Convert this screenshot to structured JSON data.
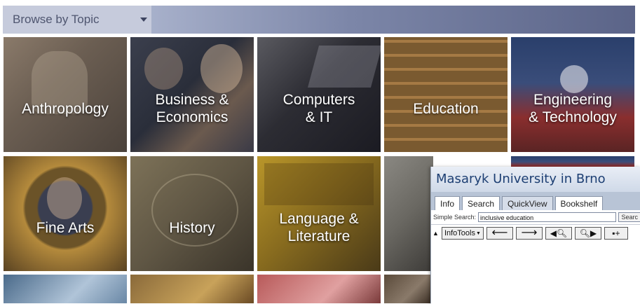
{
  "browse": {
    "label": "Browse by Topic"
  },
  "tiles": [
    {
      "label": "Anthropology"
    },
    {
      "label": "Business &\nEconomics"
    },
    {
      "label": "Computers\n& IT"
    },
    {
      "label": "Education"
    },
    {
      "label": "Engineering\n& Technology"
    },
    {
      "label": "Fine Arts"
    },
    {
      "label": "History"
    },
    {
      "label": "Language &\nLiterature"
    }
  ],
  "overlay": {
    "title": "Masaryk University in Brno",
    "tabs": [
      "Info",
      "Search",
      "QuickView",
      "Bookshelf"
    ],
    "active_tab": "QuickView",
    "simple_search_label": "Simple Search:",
    "simple_search_value": "inclusive education",
    "search_button": "Searc",
    "toolbar": {
      "infotools_label": "InfoTools"
    }
  },
  "colors": {
    "title_text": "#1d3f73",
    "browse_bar": "#7c86a8"
  }
}
